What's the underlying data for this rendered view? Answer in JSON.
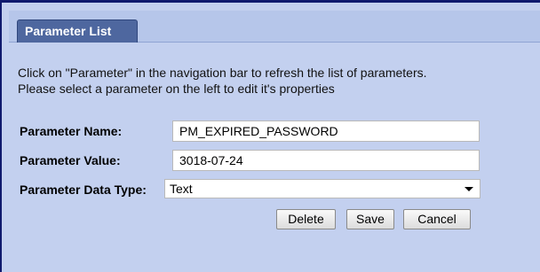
{
  "tab": {
    "label": "Parameter List"
  },
  "info": {
    "line1": "Click on \"Parameter\" in the navigation bar to refresh the list of parameters.",
    "line2": "Please select a parameter on the left to edit it's properties"
  },
  "form": {
    "name_label": "Parameter Name:",
    "name_value": "PM_EXPIRED_PASSWORD",
    "value_label": "Parameter Value:",
    "value_value": "3018-07-24",
    "type_label": "Parameter Data Type:",
    "type_value": "Text"
  },
  "buttons": {
    "delete": "Delete",
    "save": "Save",
    "cancel": "Cancel"
  },
  "colors": {
    "outer_frame": "#1a237e",
    "panel_bg": "#c3d0ef",
    "tab_bg": "#4e679f"
  }
}
